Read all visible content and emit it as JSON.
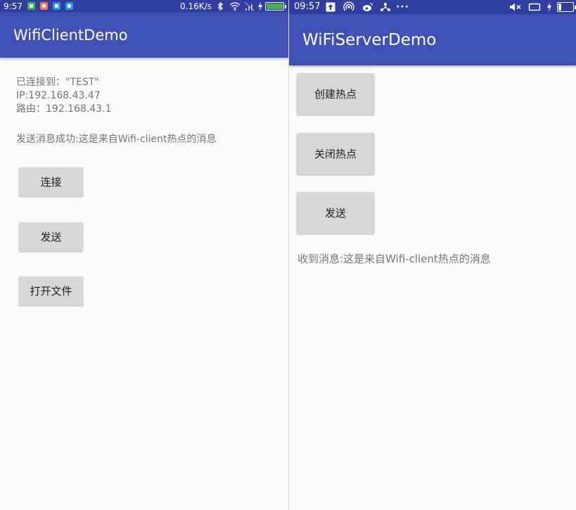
{
  "left_phone": {
    "status_bar": {
      "time": "9:57",
      "net_speed": "0.16K/s",
      "app_icon_colors": [
        "#4caf50",
        "#ff7043",
        "#2196f3",
        "#2196f3"
      ],
      "battery_color": "#4caf50"
    },
    "app_bar": {
      "title": "WifiClientDemo",
      "color": "#3f51b5"
    },
    "info": {
      "connected_to": "已连接到：\"TEST\"",
      "ip": "IP:192.168.43.47",
      "route": "路由：192.168.43.1",
      "send_result": "发送消息成功:这是来自Wifi-client热点的消息"
    },
    "buttons": {
      "connect": "连接",
      "send": "发送",
      "open_file": "打开文件"
    }
  },
  "right_phone": {
    "status_bar": {
      "time": "09:57",
      "icons": [
        "upload-icon",
        "hotspot-icon",
        "weibo-icon",
        "share-icon",
        "more-icon",
        "mute-icon",
        "screen-icon",
        "charging-icon",
        "battery-icon"
      ],
      "more": "···"
    },
    "app_bar": {
      "title": "WiFiServerDemo",
      "color": "#3f51b5"
    },
    "buttons": {
      "create_hotspot": "创建热点",
      "close_hotspot": "关闭热点",
      "send": "发送"
    },
    "received": "收到消息:这是来自Wifi-client热点的消息"
  }
}
